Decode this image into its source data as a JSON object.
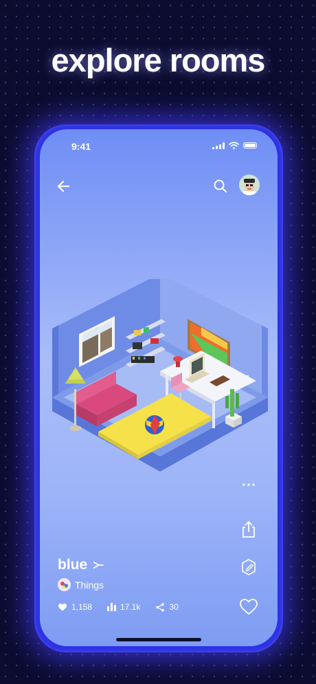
{
  "promo": {
    "headline": "explore rooms"
  },
  "status_bar": {
    "time": "9:41"
  },
  "topbar": {
    "back_icon": "arrow-left-icon",
    "search_icon": "search-icon",
    "avatar_icon": "user-avatar"
  },
  "post": {
    "title": "blue",
    "title_icon": "sparkle-icon",
    "author": "Things",
    "stats": {
      "likes": "1,158",
      "views": "17.1k",
      "shares": "30"
    }
  },
  "side_actions": [
    "more-icon",
    "share-icon",
    "edit-icon",
    "heart-icon"
  ],
  "colors": {
    "background": "#0b0c2e",
    "frame": "#2d32e6",
    "screen_top": "#6f8ef5",
    "screen_mid": "#a9bdf9",
    "rug": "#f5e14a",
    "sofa": "#d9497e"
  }
}
